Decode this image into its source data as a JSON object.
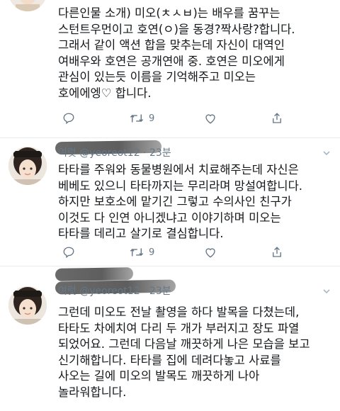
{
  "tweets": [
    {
      "header": "",
      "lines": [
        "다른인물 소개) 미오(ㅊㅅㅂ)는 배우를 꿈꾸는",
        "스턴트우먼이고 호연(ㅇ)을 동경?짝사랑?합니다.",
        "그래서 같이 액션 합을 맞추는데 자신이 대역인",
        "여배우와 호연은 공개연애 중. 호연은 미오에게",
        "관심이 있는듯 이름을 기억해주고 미오는",
        "호에에엥♡ 합니다."
      ],
      "actions": {
        "reply_count": "",
        "retweet_count": "9",
        "like_count": ""
      }
    },
    {
      "header": "여럿 @yeoreot12 · 23분",
      "lines": [
        "타타를 주워와 동물병원에서 치료해주는데 자신은",
        "베베도 있으니 타타까지는 무리라며 망설여합니다.",
        "하지만 보호소에 맡기긴 그렇고 수의사인 친구가",
        "이것도 다 인연 아니겠냐고 이야기하며 미오는",
        "타타를 데리고 살기로 결심합니다."
      ],
      "actions": {
        "reply_count": "",
        "retweet_count": "9",
        "like_count": ""
      }
    },
    {
      "header": "여럿 @yeoreot12 · 23분",
      "lines": [
        "그런데 미오도 전날 촬영을 하다 발목을 다쳤는데,",
        "타타도 차에치여 다리 두 개가 부러지고 장도 파열",
        "되었어요. 그런데 다음날 깨끗하게 나은 모습을 보고",
        "신기해합니다. 타타를 집에 데려다놓고 사료를",
        "사오는 길에 미오의 발목도 깨끗하게 나아",
        "놀라워합니다."
      ]
    }
  ],
  "icons": {
    "reply": "reply-icon",
    "retweet": "retweet-icon",
    "like": "heart-icon",
    "share": "share-icon",
    "menu": "chevron-down-icon"
  },
  "colors": {
    "text": "#14171a",
    "muted": "#657786",
    "divider": "#e6ecf0"
  }
}
